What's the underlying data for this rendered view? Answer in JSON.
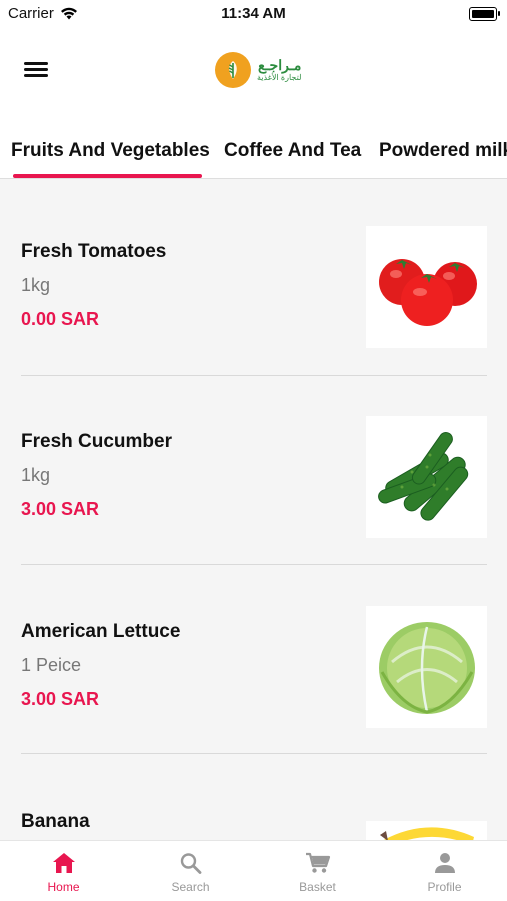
{
  "status_bar": {
    "carrier": "Carrier",
    "time": "11:34 AM"
  },
  "header": {
    "logo_text_line1": "مـراجـع",
    "logo_text_line2": "لتجارة الأغذية"
  },
  "tabs": [
    {
      "label": "Fruits And Vegetables",
      "active": true
    },
    {
      "label": "Coffee And Tea",
      "active": false
    },
    {
      "label": "Powdered milk",
      "active": false
    }
  ],
  "products": [
    {
      "name": "Fresh Tomatoes",
      "unit": "1kg",
      "price": "0.00 SAR",
      "image": "tomatoes"
    },
    {
      "name": "Fresh Cucumber",
      "unit": "1kg",
      "price": "3.00 SAR",
      "image": "cucumbers"
    },
    {
      "name": "American Lettuce",
      "unit": "1 Peice",
      "price": "3.00 SAR",
      "image": "lettuce"
    },
    {
      "name": "Banana",
      "unit": "",
      "price": "",
      "image": "banana"
    }
  ],
  "bottom_nav": [
    {
      "label": "Home",
      "icon": "home-icon",
      "active": true
    },
    {
      "label": "Search",
      "icon": "search-icon",
      "active": false
    },
    {
      "label": "Basket",
      "icon": "cart-icon",
      "active": false
    },
    {
      "label": "Profile",
      "icon": "profile-icon",
      "active": false
    }
  ],
  "colors": {
    "accent": "#e8164f",
    "logo_orange": "#f0a11f",
    "logo_green": "#2c8c3f"
  }
}
